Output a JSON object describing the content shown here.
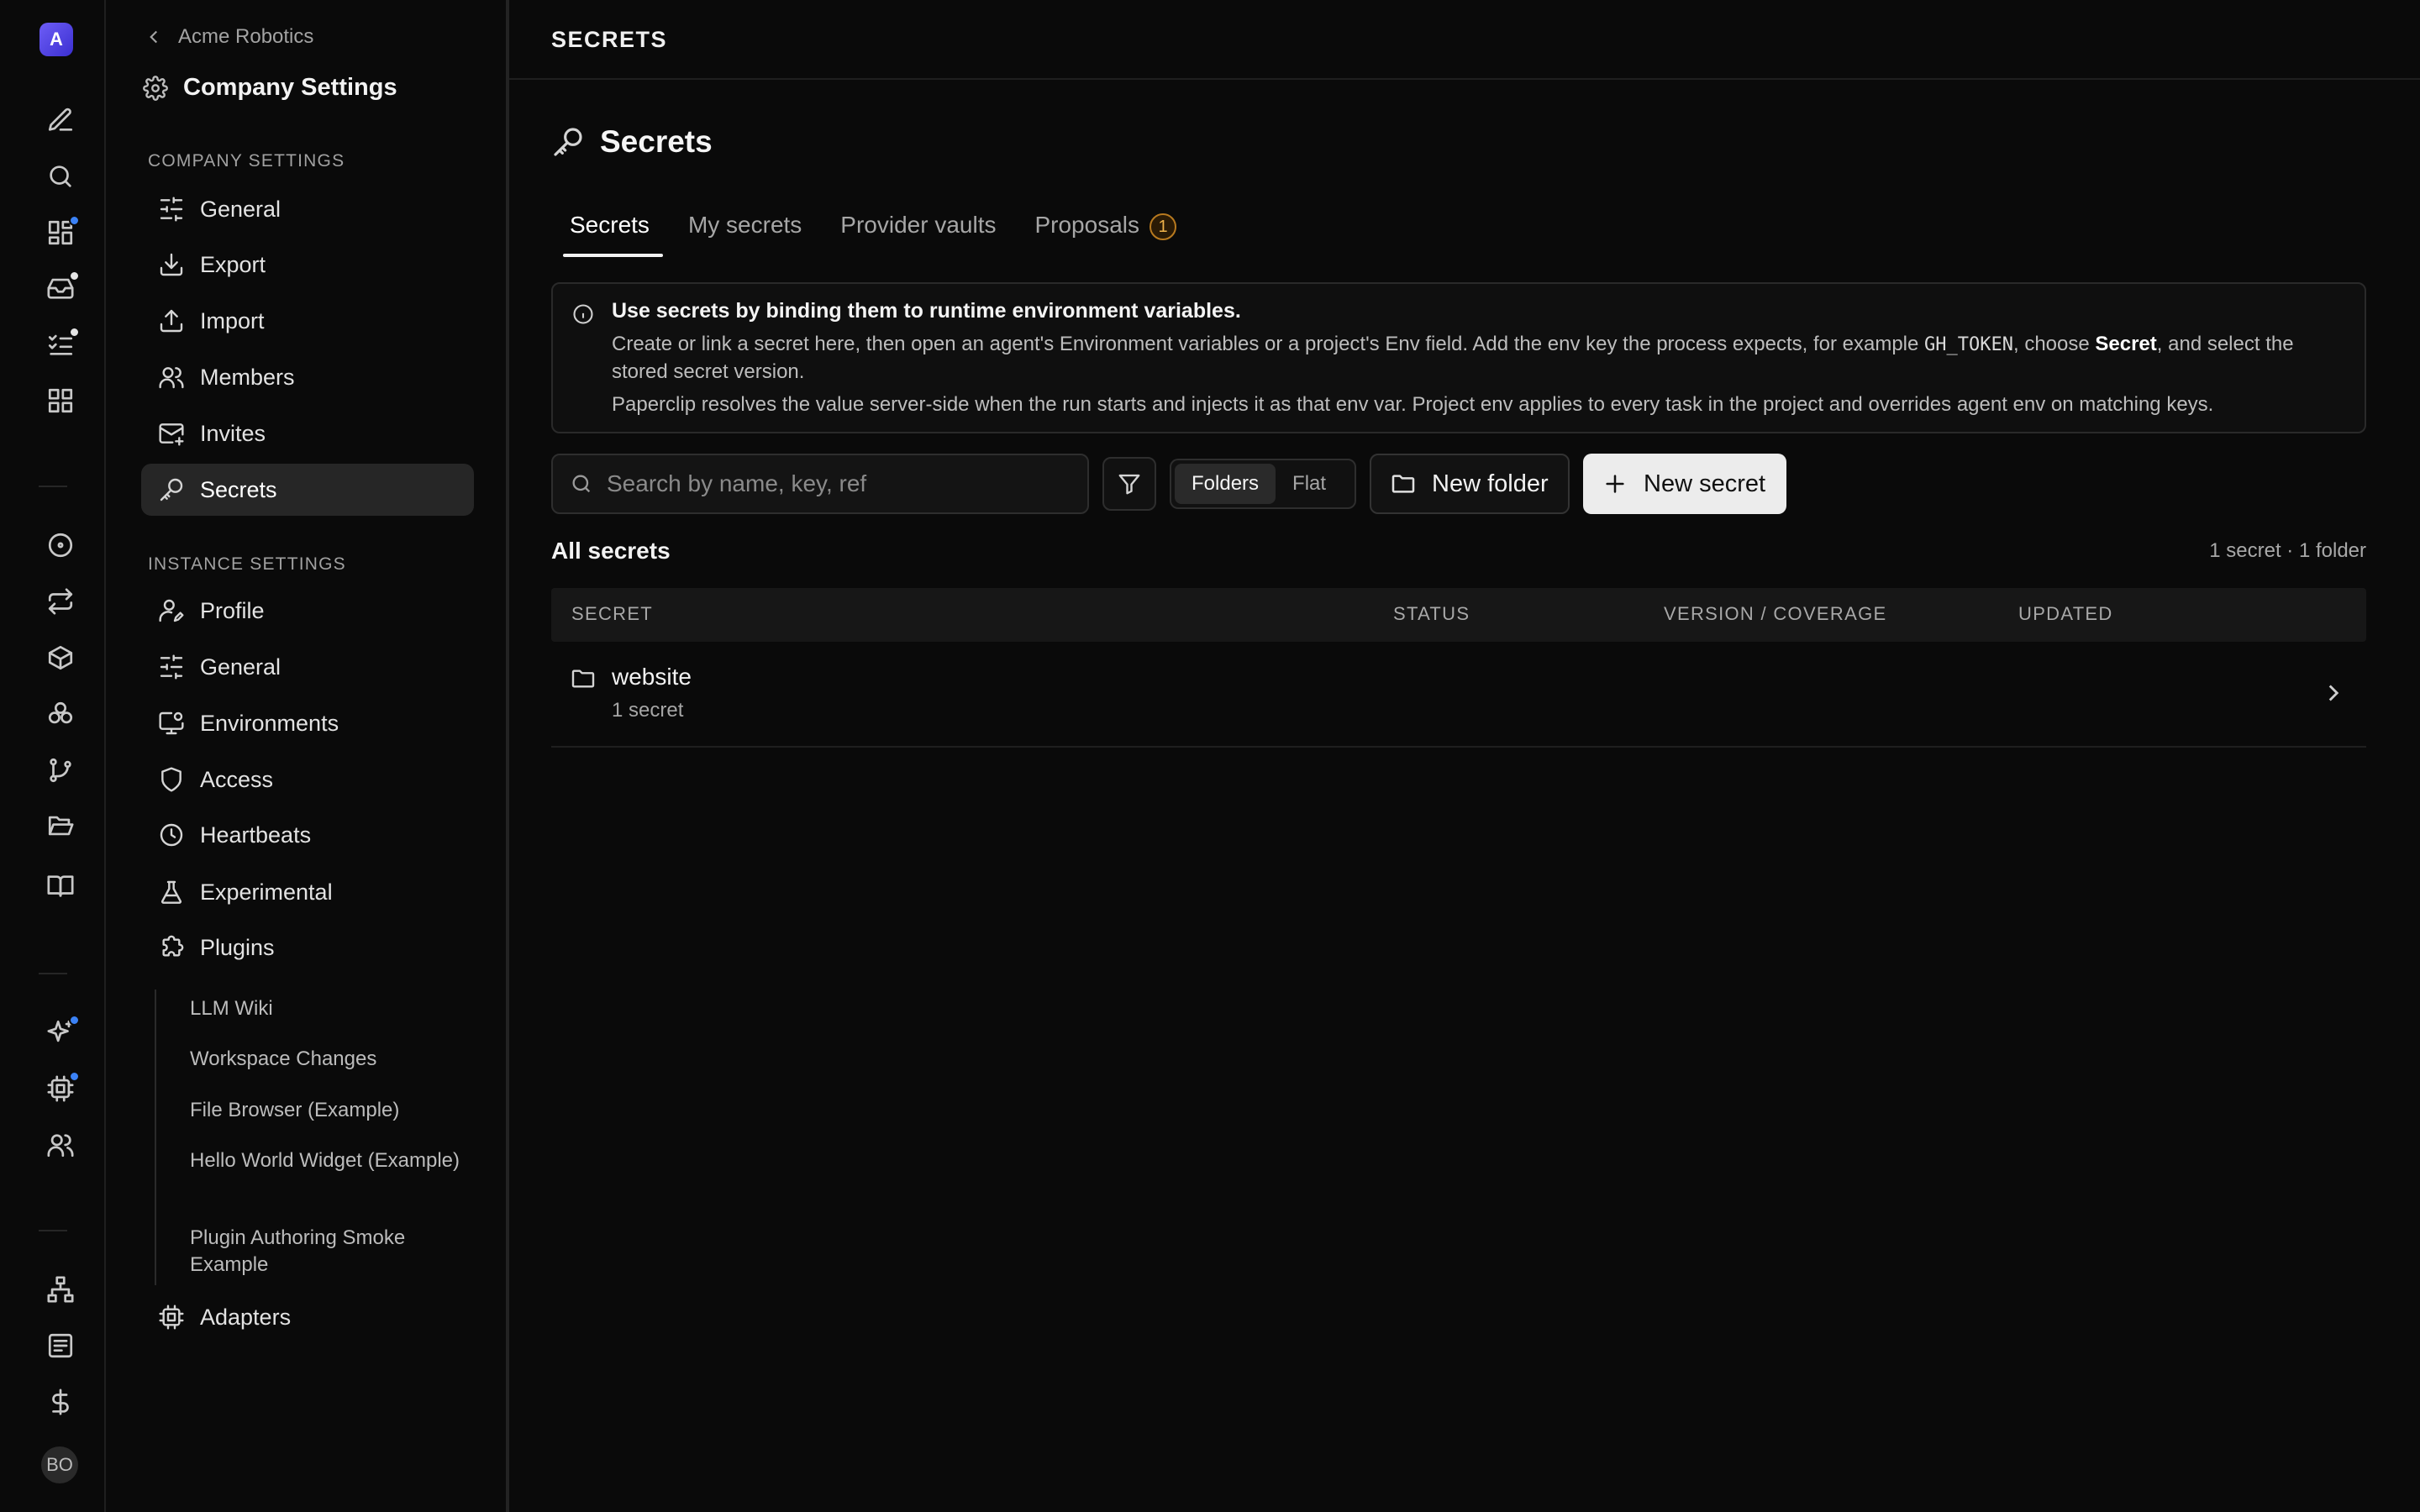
{
  "rail": {
    "company_initial": "A",
    "user_initials": "BO"
  },
  "sidebar": {
    "back_label": "Acme Robotics",
    "title": "Company Settings",
    "company_section": "COMPANY SETTINGS",
    "company_items": [
      "General",
      "Export",
      "Import",
      "Members",
      "Invites",
      "Secrets"
    ],
    "instance_section": "INSTANCE SETTINGS",
    "instance_items": [
      "Profile",
      "General",
      "Environments",
      "Access",
      "Heartbeats",
      "Experimental",
      "Plugins"
    ],
    "plugins": [
      "LLM Wiki",
      "Workspace Changes",
      "File Browser (Example)",
      "Hello World Widget (Example)",
      "Plugin Authoring Smoke Example"
    ],
    "adapters": "Adapters"
  },
  "topbar": {
    "title": "SECRETS"
  },
  "page": {
    "heading": "Secrets"
  },
  "tabs": [
    {
      "label": "Secrets"
    },
    {
      "label": "My secrets"
    },
    {
      "label": "Provider vaults"
    },
    {
      "label": "Proposals",
      "badge": "1"
    }
  ],
  "info": {
    "title": "Use secrets by binding them to runtime environment variables.",
    "line1_a": "Create or link a secret here, then open an agent's Environment variables or a project's Env field. Add the env key the process expects, for example ",
    "line1_code": "GH_TOKEN",
    "line1_b": ", choose ",
    "line1_strong": "Secret",
    "line1_c": ", and select the stored secret version.",
    "line2": "Paperclip resolves the value server-side when the run starts and injects it as that env var. Project env applies to every task in the project and overrides agent env on matching keys."
  },
  "toolbar": {
    "search_placeholder": "Search by name, key, ref",
    "view_folders": "Folders",
    "view_flat": "Flat",
    "new_folder": "New folder",
    "new_secret": "New secret"
  },
  "list": {
    "title": "All secrets",
    "count": "1 secret · 1 folder",
    "columns": [
      "SECRET",
      "STATUS",
      "VERSION / COVERAGE",
      "UPDATED"
    ],
    "rows": [
      {
        "name": "website",
        "sub": "1 secret"
      }
    ]
  }
}
